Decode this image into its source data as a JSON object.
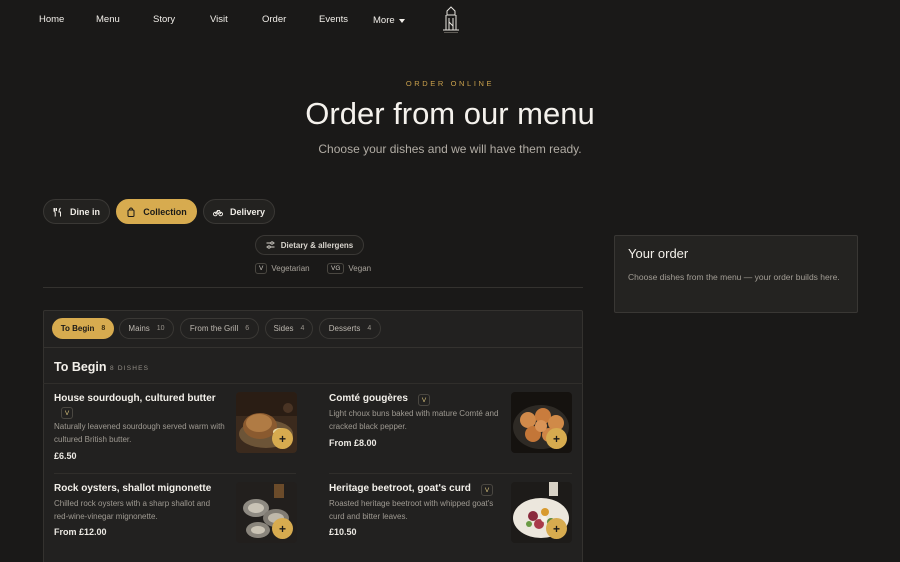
{
  "nav": {
    "items": [
      "Home",
      "Menu",
      "Story",
      "Visit",
      "Order",
      "Events"
    ],
    "more_label": "More"
  },
  "hero": {
    "eyebrow": "ORDER ONLINE",
    "title": "Order from our menu",
    "subtitle": "Choose your dishes and we will have them ready."
  },
  "modes": [
    {
      "label": "Dine in",
      "icon": "cutlery-icon",
      "active": false
    },
    {
      "label": "Collection",
      "icon": "bag-icon",
      "active": true
    },
    {
      "label": "Delivery",
      "icon": "bike-icon",
      "active": false
    }
  ],
  "dietary": {
    "button_label": "Dietary & allergens",
    "legend": [
      {
        "tag": "V",
        "label": "Vegetarian"
      },
      {
        "tag": "VG",
        "label": "Vegan"
      }
    ]
  },
  "categories": [
    {
      "label": "To Begin",
      "count": "8",
      "active": true
    },
    {
      "label": "Mains",
      "count": "10",
      "active": false
    },
    {
      "label": "From the Grill",
      "count": "6",
      "active": false
    },
    {
      "label": "Sides",
      "count": "4",
      "active": false
    },
    {
      "label": "Desserts",
      "count": "4",
      "active": false
    }
  ],
  "section": {
    "title": "To Begin",
    "count_label": "8 DISHES"
  },
  "dishes": [
    {
      "name": "House sourdough, cultured butter",
      "tag": "V",
      "description": "Naturally leavened sourdough served warm with cultured British butter.",
      "price": "£6.50"
    },
    {
      "name": "Comté gougères",
      "tag": "V",
      "description": "Light choux buns baked with mature Comté and cracked black pepper.",
      "price": "From £8.00"
    },
    {
      "name": "Rock oysters, shallot mignonette",
      "tag": "",
      "description": "Chilled rock oysters with a sharp shallot and red-wine-vinegar mignonette.",
      "price": "From £12.00"
    },
    {
      "name": "Heritage beetroot, goat's curd",
      "tag": "V",
      "description": "Roasted heritage beetroot with whipped goat's curd and bitter leaves.",
      "price": "£10.50"
    }
  ],
  "add_symbol": "+",
  "order": {
    "title": "Your order",
    "empty_text": "Choose dishes from the menu — your order builds here."
  },
  "colors": {
    "background": "#1a1918",
    "accent": "#d7ab4f",
    "panel": "#222120"
  }
}
